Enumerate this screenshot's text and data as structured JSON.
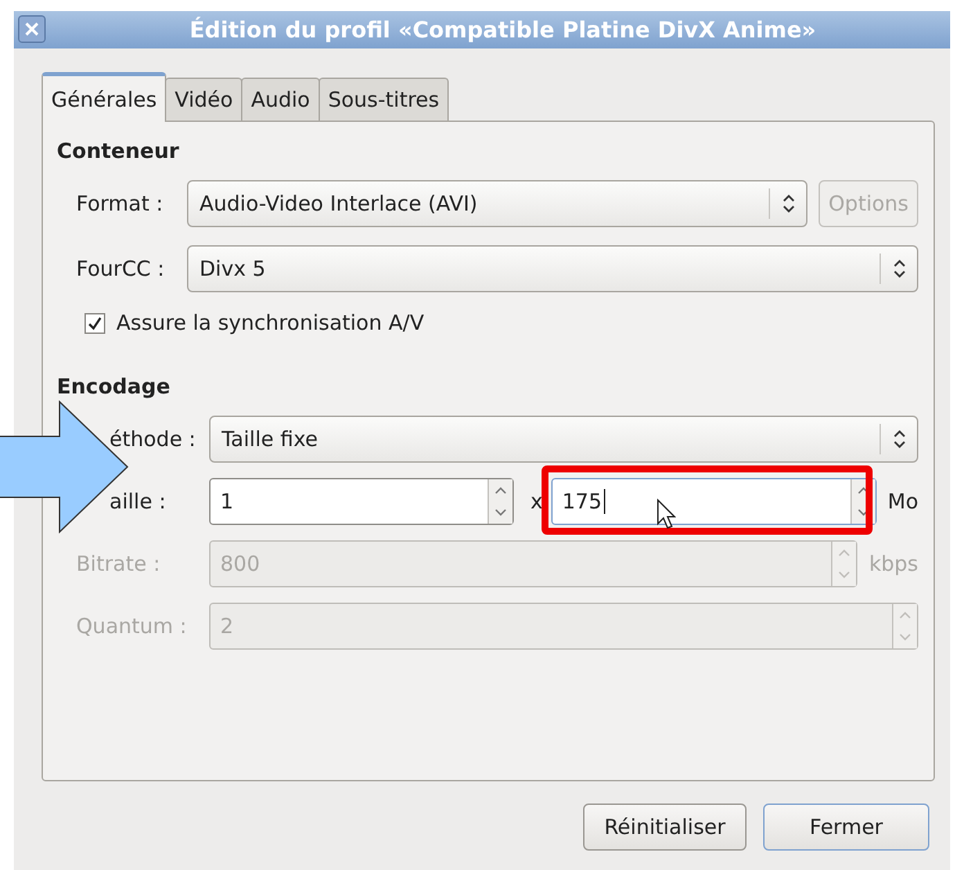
{
  "window": {
    "title": "Édition du profil «Compatible Platine DivX Anime»"
  },
  "tabs": [
    {
      "label": "Générales",
      "selected": true
    },
    {
      "label": "Vidéo",
      "selected": false
    },
    {
      "label": "Audio",
      "selected": false
    },
    {
      "label": "Sous-titres",
      "selected": false
    }
  ],
  "sections": [
    {
      "heading": "Conteneur",
      "rows": [
        {
          "kind": "combo",
          "label": "Format :",
          "value": "Audio-Video Interlace (AVI)",
          "button": {
            "label": "Options",
            "disabled": true
          }
        },
        {
          "kind": "combo",
          "label": "FourCC :",
          "value": "Divx 5"
        },
        {
          "kind": "checkbox",
          "label": "Assure la synchronisation A/V",
          "checked": true
        }
      ]
    },
    {
      "heading": "Encodage",
      "rows": [
        {
          "kind": "combo",
          "label": "éthode :",
          "value": "Taille fixe"
        },
        {
          "kind": "spin-pair",
          "label": "aille :",
          "separator": "x",
          "unit": "Mo",
          "fields": [
            {
              "value": "1",
              "focused": false
            },
            {
              "value": "175",
              "focused": true
            }
          ]
        },
        {
          "kind": "spin",
          "label": "Bitrate :",
          "value": "800",
          "unit": "kbps",
          "disabled": true
        },
        {
          "kind": "spin",
          "label": "Quantum :",
          "value": "2",
          "disabled": true
        }
      ]
    }
  ],
  "buttons": [
    {
      "label": "Réinitialiser",
      "focused": false
    },
    {
      "label": "Fermer",
      "focused": true
    }
  ]
}
